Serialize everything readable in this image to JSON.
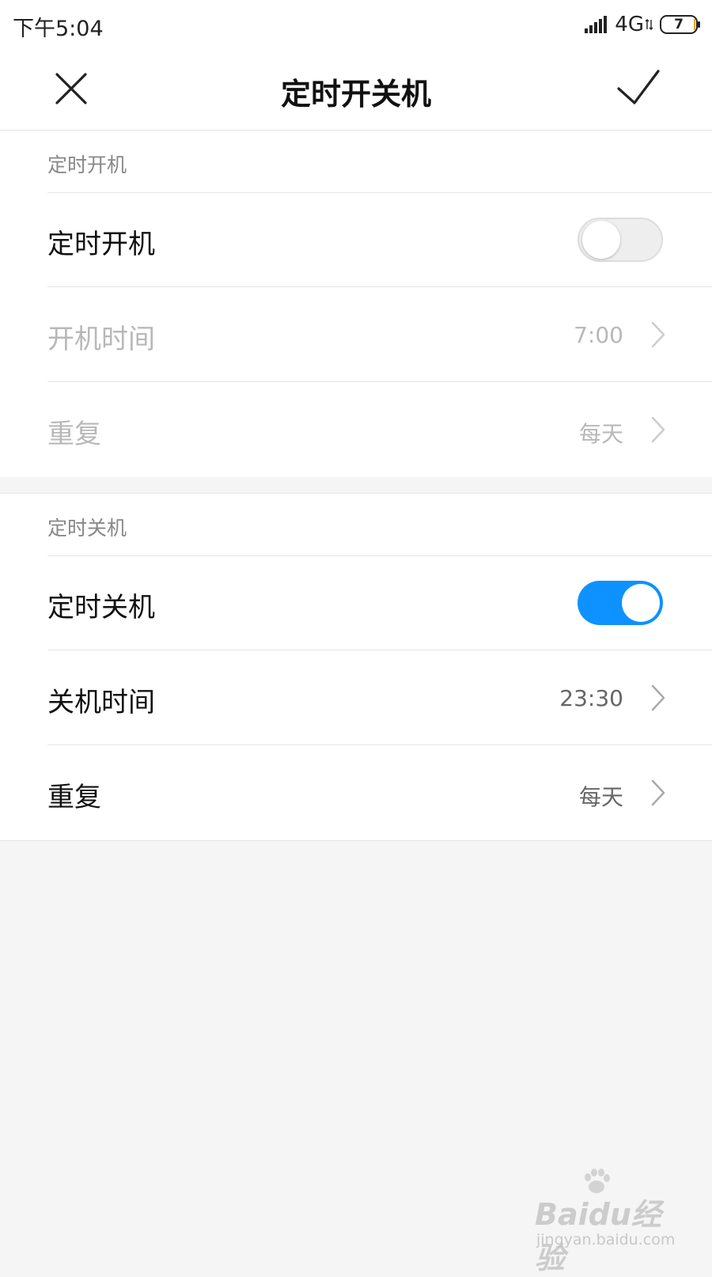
{
  "status_bar": {
    "time": "下午5:04",
    "network": "4G",
    "battery": "7"
  },
  "header": {
    "title": "定时开关机",
    "close_icon": "close-icon",
    "confirm_icon": "checkmark-icon"
  },
  "power_on": {
    "section_title": "定时开机",
    "toggle_label": "定时开机",
    "toggle_state": "off",
    "time_label": "开机时间",
    "time_value": "7:00",
    "repeat_label": "重复",
    "repeat_value": "每天"
  },
  "power_off": {
    "section_title": "定时关机",
    "toggle_label": "定时关机",
    "toggle_state": "on",
    "time_label": "关机时间",
    "time_value": "23:30",
    "repeat_label": "重复",
    "repeat_value": "每天"
  },
  "watermark": {
    "logo": "Baidu经验",
    "url": "jingyan.baidu.com"
  },
  "colors": {
    "accent": "#0d92ff",
    "background": "#f5f5f5",
    "disabled_text": "#b8b8b8"
  }
}
